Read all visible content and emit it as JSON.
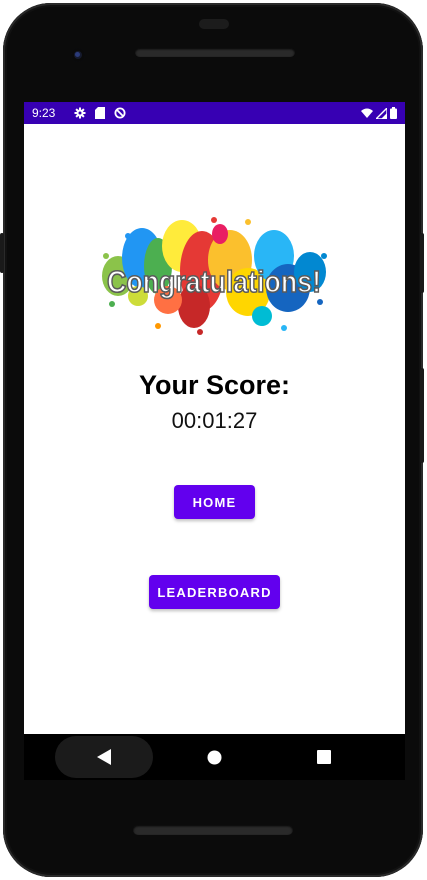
{
  "status_bar": {
    "time": "9:23",
    "left_icons": [
      "gear-icon",
      "sd-card-icon",
      "sync-icon"
    ],
    "right_icons": [
      "wifi-icon",
      "cell-signal-icon",
      "battery-icon"
    ],
    "background": "#3700b3"
  },
  "content": {
    "banner_text": "Congratulations!",
    "score_label": "Your Score:",
    "score_value": "00:01:27"
  },
  "buttons": {
    "home_label": "HOME",
    "leaderboard_label": "LEADERBOARD",
    "color": "#6200ee"
  },
  "nav_bar": {
    "back_icon": "back-triangle-icon",
    "home_icon": "home-circle-icon",
    "recents_icon": "recents-square-icon"
  }
}
